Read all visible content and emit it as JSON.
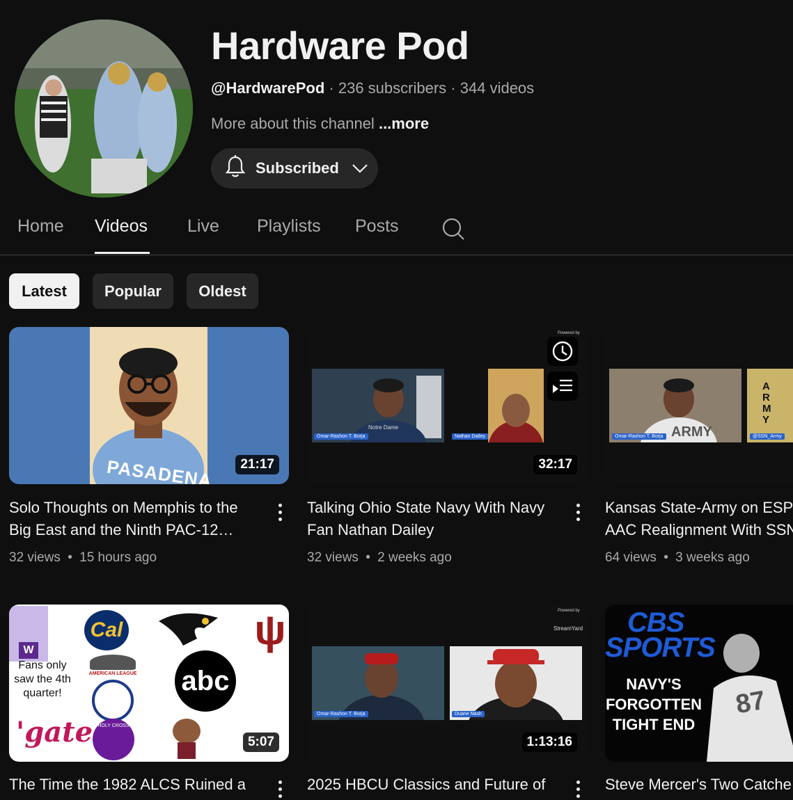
{
  "channel": {
    "name": "Hardware Pod",
    "handle": "@HardwarePod",
    "subscribers": "236 subscribers",
    "video_count": "344 videos",
    "separator": "·",
    "about": "More about this channel",
    "more": "...more",
    "subscribe_label": "Subscribed"
  },
  "tabs": [
    {
      "label": "Home"
    },
    {
      "label": "Videos"
    },
    {
      "label": "Live"
    },
    {
      "label": "Playlists"
    },
    {
      "label": "Posts"
    }
  ],
  "active_tab": "Videos",
  "filters": [
    {
      "label": "Latest"
    },
    {
      "label": "Popular"
    },
    {
      "label": "Oldest"
    }
  ],
  "active_filter": "Latest",
  "videos": [
    {
      "title_line1": "Solo Thoughts on Memphis to the",
      "title_line2": "Big East and the Ninth PAC-12…",
      "views": "32 views",
      "age": "15 hours ago",
      "duration": "21:17"
    },
    {
      "title_line1": "Talking Ohio State Navy With Navy",
      "title_line2": "Fan Nathan Dailey",
      "views": "32 views",
      "age": "2 weeks ago",
      "duration": "32:17"
    },
    {
      "title_line1": "Kansas State-Army on ESP",
      "title_line2": "AAC Realignment With SSN",
      "views": "64 views",
      "age": "3 weeks ago",
      "duration": ""
    },
    {
      "title_line1": "The Time the 1982 ALCS Ruined a",
      "duration": "5:07"
    },
    {
      "title_line1": "2025 HBCU Classics and Future of",
      "duration": "1:13:16"
    },
    {
      "title_line1": "Steve Mercer's Two Catche"
    }
  ],
  "meta_separator": "•",
  "thumb_text": {
    "v1_shirt": "PASADENA",
    "v2_name_left": "Omar-Rashon T. Borja",
    "v2_name_right": "Nathan Dailey",
    "v2_shirt": "Notre Dame",
    "v2_powered": "Powered by",
    "v3_name_left": "Omar-Rashon T. Borja",
    "v3_name_right": "@SSN_Army",
    "v3_army": "ARMY",
    "v4_fans": "Fans only saw the 4th quarter!",
    "v4_cal": "Cal",
    "v4_abc": "abc",
    "v4_gate": "'gate",
    "v4_w": "W",
    "v4_al": "AMERICAN LEAGUE",
    "v4_hc": "HOLY CROSS",
    "v5_powered": "Powered by",
    "v5_brand": "StreamYard",
    "v5_name_left": "Omar-Rashon T. Borja",
    "v5_name_right": "Duane Nash",
    "v6_logo_top": "CBS",
    "v6_logo_bottom": "SPORTS",
    "v6_line1": "NAVY'S",
    "v6_line2": "FORGOTTEN",
    "v6_line3": "TIGHT END",
    "v6_jersey": "87"
  },
  "colors": {
    "background": "#0f0f0f",
    "chip": "#272727",
    "text": "#f1f1f1",
    "secondary": "#aaaaaa",
    "name_bar": "#2a62c9"
  }
}
